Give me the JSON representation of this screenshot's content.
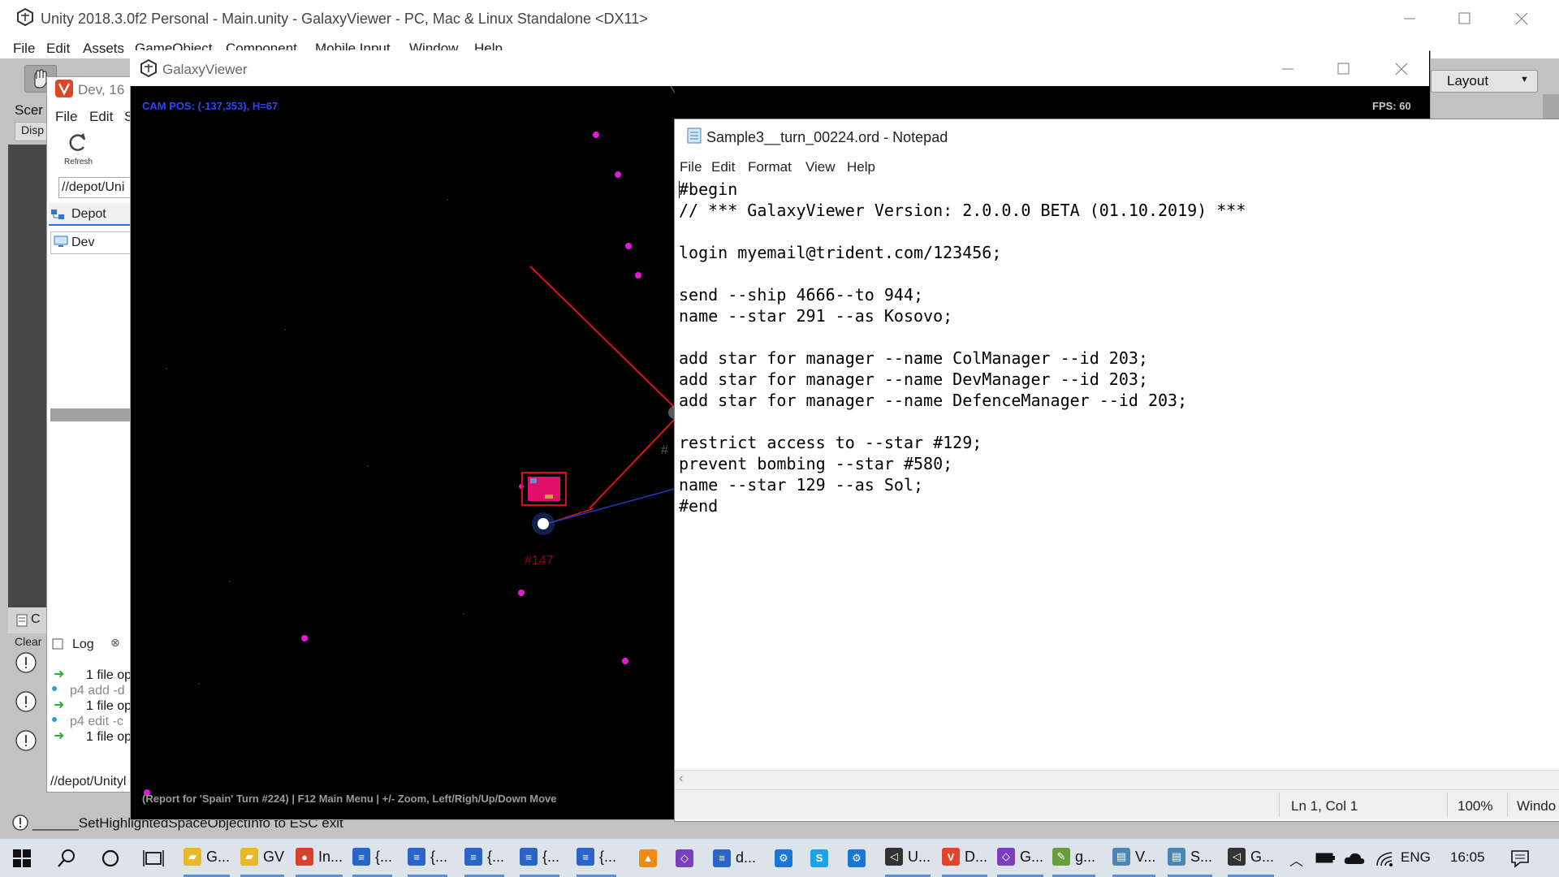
{
  "unity": {
    "title": "Unity 2018.3.0f2 Personal - Main.unity - GalaxyViewer - PC, Mac & Linux Standalone <DX11>",
    "menu": [
      "File",
      "Edit",
      "Assets",
      "GameObject",
      "Component",
      "Mobile Input",
      "Window",
      "Help"
    ],
    "layout_label": "Layout",
    "scene_tab": "Scer",
    "display_button": "Disp",
    "console_tab": "C",
    "console_clear": "Clear",
    "status_text": "______SetHighlightedSpaceObjectInfo to ESC exit"
  },
  "p4v": {
    "title": "Dev,  16",
    "menu": [
      "File",
      "Edit",
      "S"
    ],
    "refresh_label": "Refresh",
    "path": "//depot/Uni",
    "depot_tab": "Depot",
    "dev_item": "Dev",
    "log_tab": "Log",
    "log_lines": [
      {
        "kind": "result",
        "text": "1 file op"
      },
      {
        "kind": "cmd",
        "text": "p4 add -d"
      },
      {
        "kind": "result",
        "text": "1 file op"
      },
      {
        "kind": "cmd",
        "text": "p4 edit -c"
      },
      {
        "kind": "result",
        "text": "1 file op"
      }
    ],
    "bottom_path": "//depot/Unityl"
  },
  "galaxy": {
    "title": "GalaxyViewer",
    "cam_pos": "CAM POS: (-137,353), H=67",
    "fps": "FPS: 60",
    "footer": "(Report for 'Spain' Turn #224) | F12 Main Menu | +/- Zoom, Left/Righ/Up/Down Move",
    "star_label": "#147",
    "star_label_partial": "#",
    "colors": {
      "cam_text": "#2b45ff",
      "route_red": "#e0101a",
      "route_blue": "#1c3cc8",
      "star_magenta": "#e21ad9"
    }
  },
  "notepad": {
    "title": "Sample3__turn_00224.ord - Notepad",
    "menu": [
      "File",
      "Edit",
      "Format",
      "View",
      "Help"
    ],
    "lines": [
      "#begin",
      "// *** GalaxyViewer Version: 2.0.0.0 BETA (01.10.2019) ***",
      "",
      "login myemail@trident.com/123456;",
      "",
      "send --ship 4666--to 944;",
      "name --star 291 --as Kosovo;",
      "",
      "add star for manager --name ColManager --id 203;",
      "add star for manager --name DevManager --id 203;",
      "add star for manager --name DefenceManager --id 203;",
      "",
      "restrict access to --star #129;",
      "prevent bombing --star #580;",
      "name --star 129 --as Sol;",
      "#end"
    ],
    "status_position": "Ln 1, Col 1",
    "status_zoom": "100%",
    "status_eol": "Windo"
  },
  "taskbar": {
    "items": [
      {
        "id": "explorer-1",
        "icon": "folder-icon",
        "label": "G..."
      },
      {
        "id": "explorer-2",
        "icon": "folder-icon",
        "label": "GV"
      },
      {
        "id": "chrome",
        "icon": "chrome-icon",
        "label": "In..."
      },
      {
        "id": "vs-code-1",
        "icon": "document-icon",
        "label": "{..."
      },
      {
        "id": "vs-code-2",
        "icon": "document-icon",
        "label": "{..."
      },
      {
        "id": "vs-code-3",
        "icon": "document-icon",
        "label": "{..."
      },
      {
        "id": "vs-code-4",
        "icon": "document-icon",
        "label": "{..."
      },
      {
        "id": "vs-code-5",
        "icon": "document-icon",
        "label": "{..."
      },
      {
        "id": "vlc",
        "icon": "vlc-icon",
        "label": ""
      },
      {
        "id": "visual-studio",
        "icon": "visual-studio-icon",
        "label": ""
      },
      {
        "id": "doc-app",
        "icon": "document-icon",
        "label": "d..."
      },
      {
        "id": "settings",
        "icon": "gear-icon",
        "label": ""
      },
      {
        "id": "skype",
        "icon": "skype-icon",
        "label": ""
      },
      {
        "id": "tools",
        "icon": "gear-icon",
        "label": ""
      },
      {
        "id": "unity",
        "icon": "unity-icon",
        "label": "U..."
      },
      {
        "id": "vivaldi",
        "icon": "vivaldi-icon",
        "label": "D..."
      },
      {
        "id": "vs-2",
        "icon": "visual-studio-icon",
        "label": "G..."
      },
      {
        "id": "paint",
        "icon": "paint-icon",
        "label": "g..."
      },
      {
        "id": "notepad-1",
        "icon": "notepad-icon",
        "label": "V..."
      },
      {
        "id": "notepad-2",
        "icon": "notepad-icon",
        "label": "S..."
      },
      {
        "id": "unity-2",
        "icon": "unity-icon",
        "label": "G..."
      }
    ],
    "language": "ENG",
    "time": "16:05"
  }
}
